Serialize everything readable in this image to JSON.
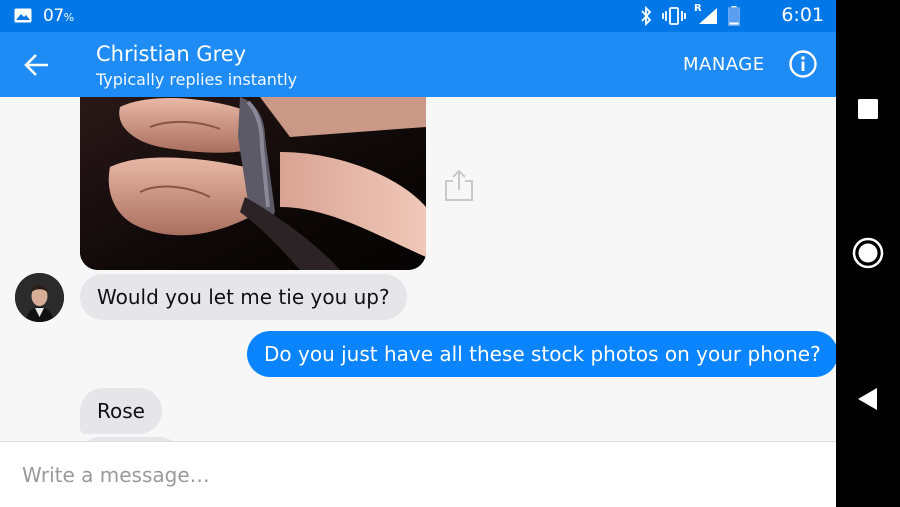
{
  "status_bar": {
    "battery_percent": "07",
    "percent_sign": "%",
    "roaming_indicator": "R",
    "time": "6:01",
    "icons": [
      "image-icon",
      "bluetooth-icon",
      "vibrate-icon",
      "signal-icon",
      "battery-icon"
    ]
  },
  "header": {
    "contact_name": "Christian Grey",
    "subtitle": "Typically replies instantly",
    "manage_label": "MANAGE",
    "icons": [
      "back-arrow-icon",
      "info-icon"
    ]
  },
  "messages": [
    {
      "direction": "incoming",
      "type": "image",
      "image_name": "tied-wrists-photo"
    },
    {
      "direction": "incoming",
      "type": "text",
      "text": "Would you let me tie you up?"
    },
    {
      "direction": "outgoing",
      "type": "text",
      "text": "Do you just have all these stock photos on your phone?"
    },
    {
      "direction": "incoming",
      "type": "text",
      "text": "Rose"
    }
  ],
  "composer": {
    "placeholder": "Write a message…",
    "value": ""
  },
  "nav_bar": {
    "icons": [
      "recents-square-icon",
      "home-circle-icon",
      "back-triangle-icon"
    ]
  },
  "colors": {
    "status_bar": "#0278e8",
    "app_bar": "#1f8cf6",
    "outgoing_bubble": "#0a84ff",
    "incoming_bubble": "#e6e6e8",
    "chat_background": "#f7f7f7"
  }
}
